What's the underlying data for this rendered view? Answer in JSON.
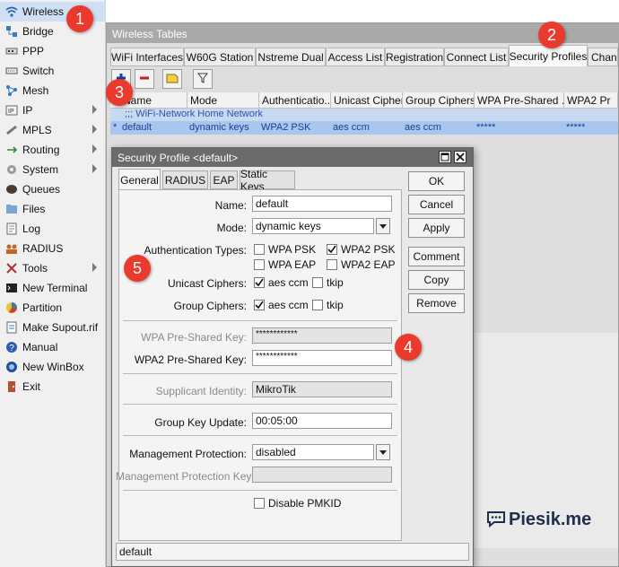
{
  "sidebar": {
    "items": [
      {
        "label": "Wireless",
        "icon": "wifi-icon"
      },
      {
        "label": "Bridge",
        "icon": "bridge-icon"
      },
      {
        "label": "PPP",
        "icon": "ppp-icon"
      },
      {
        "label": "Switch",
        "icon": "switch-icon"
      },
      {
        "label": "Mesh",
        "icon": "mesh-icon"
      },
      {
        "label": "IP",
        "icon": "ip-icon",
        "submenu": true
      },
      {
        "label": "MPLS",
        "icon": "mpls-icon",
        "submenu": true
      },
      {
        "label": "Routing",
        "icon": "routing-icon",
        "submenu": true
      },
      {
        "label": "System",
        "icon": "gear-icon",
        "submenu": true
      },
      {
        "label": "Queues",
        "icon": "queues-icon"
      },
      {
        "label": "Files",
        "icon": "folder-icon"
      },
      {
        "label": "Log",
        "icon": "log-icon"
      },
      {
        "label": "RADIUS",
        "icon": "radius-icon"
      },
      {
        "label": "Tools",
        "icon": "tools-icon",
        "submenu": true
      },
      {
        "label": "New Terminal",
        "icon": "terminal-icon"
      },
      {
        "label": "Partition",
        "icon": "partition-icon"
      },
      {
        "label": "Make Supout.rif",
        "icon": "supout-icon"
      },
      {
        "label": "Manual",
        "icon": "help-icon"
      },
      {
        "label": "New WinBox",
        "icon": "winbox-icon"
      },
      {
        "label": "Exit",
        "icon": "exit-icon"
      }
    ]
  },
  "main": {
    "title": "Wireless Tables",
    "tabs": [
      "WiFi Interfaces",
      "W60G Station",
      "Nstreme Dual",
      "Access List",
      "Registration",
      "Connect List",
      "Security Profiles",
      "Chan"
    ],
    "active_tab": "Security Profiles",
    "columns": [
      "Name",
      "Mode",
      "Authenticatio...",
      "Unicast Ciphers",
      "Group Ciphers",
      "WPA Pre-Shared ...",
      "WPA2 Pr"
    ],
    "comment_row": ";;; WiFi-Network Home Network",
    "row": {
      "marker": "*",
      "name": "default",
      "mode": "dynamic keys",
      "auth": "WPA2 PSK",
      "unicast": "aes ccm",
      "group": "aes ccm",
      "wpa_psk": "*****",
      "wpa2_psk": "*****"
    }
  },
  "dialog": {
    "title": "Security Profile <default>",
    "tabs": [
      "General",
      "RADIUS",
      "EAP",
      "Static Keys"
    ],
    "labels": {
      "name": "Name:",
      "mode": "Mode:",
      "auth_types": "Authentication Types:",
      "unicast": "Unicast Ciphers:",
      "group": "Group Ciphers:",
      "wpa_psk": "WPA Pre-Shared Key:",
      "wpa2_psk": "WPA2 Pre-Shared Key:",
      "supplicant": "Supplicant Identity:",
      "gku": "Group Key Update:",
      "mgmt_prot": "Management Protection:",
      "mgmt_key": "Management Protection Key:"
    },
    "values": {
      "name": "default",
      "mode": "dynamic keys",
      "wpa_psk": "************",
      "wpa2_psk": "************",
      "supplicant": "MikroTik",
      "gku": "00:05:00",
      "mgmt_prot": "disabled",
      "mgmt_key": ""
    },
    "checks": {
      "wpa_psk": {
        "label": "WPA PSK",
        "checked": false
      },
      "wpa2_psk": {
        "label": "WPA2 PSK",
        "checked": true
      },
      "wpa_eap": {
        "label": "WPA EAP",
        "checked": false
      },
      "wpa2_eap": {
        "label": "WPA2 EAP",
        "checked": false
      },
      "uni_aes": {
        "label": "aes ccm",
        "checked": true
      },
      "uni_tkip": {
        "label": "tkip",
        "checked": false
      },
      "grp_aes": {
        "label": "aes ccm",
        "checked": true
      },
      "grp_tkip": {
        "label": "tkip",
        "checked": false
      },
      "pmkid": {
        "label": "Disable PMKID",
        "checked": false
      }
    },
    "buttons": [
      "OK",
      "Cancel",
      "Apply",
      "Comment",
      "Copy",
      "Remove"
    ],
    "status": "default"
  },
  "badges": [
    "1",
    "2",
    "3",
    "4",
    "5"
  ],
  "watermark": "Piesik.me",
  "colors": {
    "badge": "#ea3a2e",
    "selection": "#b8d2f0",
    "accent": "#1f3c9c"
  }
}
